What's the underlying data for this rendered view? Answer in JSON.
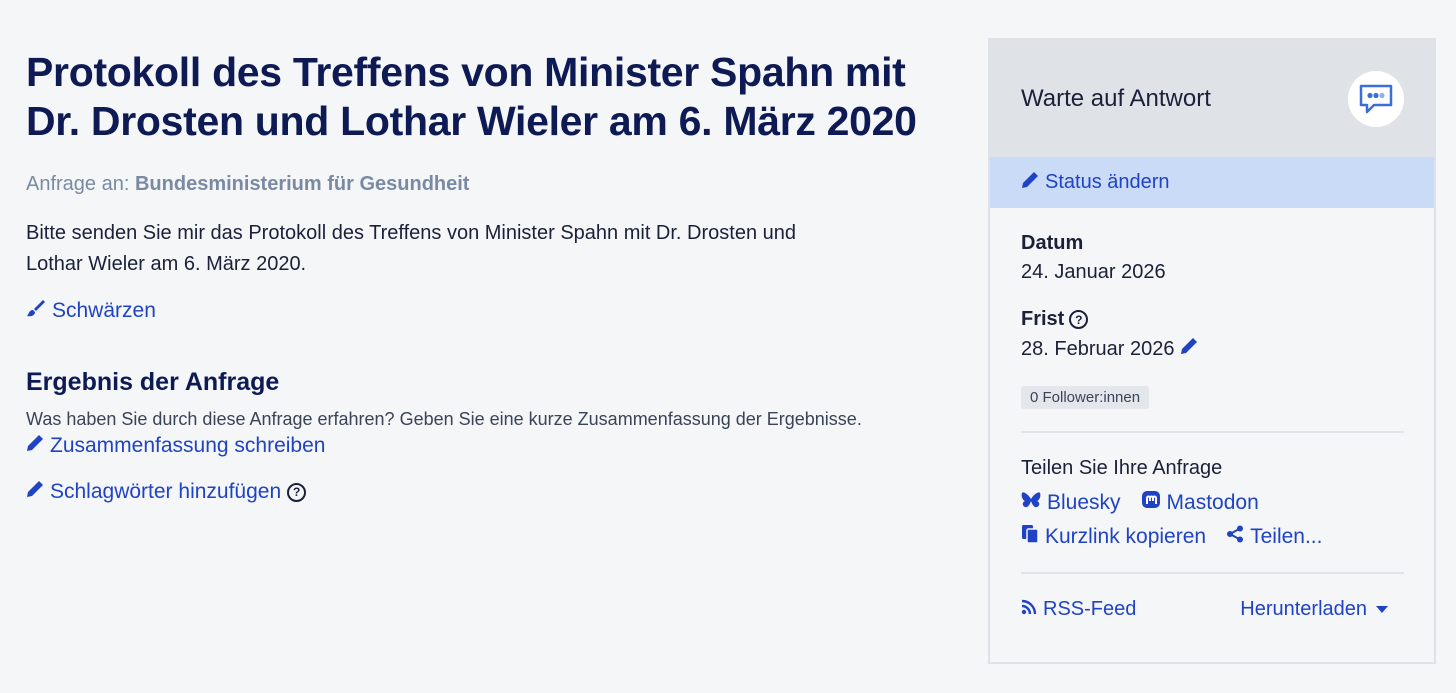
{
  "request": {
    "title": "Protokoll des Treffens von Minister Spahn mit Dr. Drosten und Lothar Wieler am 6. März 2020",
    "recipient_label": "Anfrage an:",
    "recipient": "Bundesministerium für Gesundheit",
    "body": "Bitte senden Sie mir das Protokoll des Treffens von Minister Spahn mit Dr. Drosten und Lothar Wieler am 6. März 2020.",
    "redact_label": "Schwärzen"
  },
  "result": {
    "heading": "Ergebnis der Anfrage",
    "hint": "Was haben Sie durch diese Anfrage erfahren? Geben Sie eine kurze Zusammenfassung der Ergebnisse.",
    "summary_link": "Zusammenfassung schreiben",
    "tags_link": "Schlagwörter hinzufügen"
  },
  "sidebar": {
    "status": "Warte auf Antwort",
    "change_status": "Status ändern",
    "date_label": "Datum",
    "date_value": "24. Januar 2026",
    "deadline_label": "Frist",
    "deadline_value": "28. Februar 2026",
    "followers": "0 Follower:innen",
    "share_title": "Teilen Sie Ihre Anfrage",
    "share_bluesky": "Bluesky",
    "share_mastodon": "Mastodon",
    "share_shortlink": "Kurzlink kopieren",
    "share_more": "Teilen...",
    "rss": "RSS-Feed",
    "download": "Herunterladen"
  },
  "colors": {
    "link": "#1f43c4",
    "title": "#0d1a54",
    "status_bar": "#c9dbf7"
  },
  "icons": [
    "pencil-icon",
    "brush-icon",
    "question-icon",
    "speech-bubble-icon",
    "bluesky-icon",
    "mastodon-icon",
    "copy-icon",
    "share-icon",
    "rss-icon",
    "caret-down-icon"
  ]
}
